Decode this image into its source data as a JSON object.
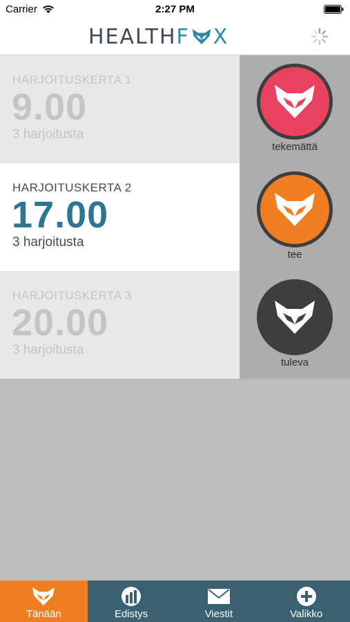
{
  "status_bar": {
    "carrier": "Carrier",
    "time": "2:27 PM"
  },
  "header": {
    "logo_text_left": "HEALTH",
    "logo_text_f": "F",
    "logo_text_x": "X",
    "logo_icon": "fox-head-icon",
    "right_icon": "loading-spinner-icon"
  },
  "sessions": [
    {
      "label": "HARJOITUSKERTA 1",
      "time": "9.00",
      "count": "3 harjoitusta",
      "active": false
    },
    {
      "label": "HARJOITUSKERTA 2",
      "time": "17.00",
      "count": "3 harjoitusta",
      "active": true
    },
    {
      "label": "HARJOITUSKERTA 3",
      "time": "20.00",
      "count": "3 harjoitusta",
      "active": false
    }
  ],
  "statuses": [
    {
      "label": "tekemättä",
      "color": "#e8425f",
      "icon": "fox-head-icon"
    },
    {
      "label": "tee",
      "color": "#f07f22",
      "icon": "fox-head-icon"
    },
    {
      "label": "tuleva",
      "color": "#3e3d3f",
      "icon": "fox-head-icon"
    }
  ],
  "tabs": [
    {
      "label": "Tänään",
      "icon": "fox-head-icon",
      "selected": true
    },
    {
      "label": "Edistys",
      "icon": "progress-chart-icon",
      "selected": false
    },
    {
      "label": "Viestit",
      "icon": "envelope-icon",
      "selected": false
    },
    {
      "label": "Valikko",
      "icon": "plus-circle-icon",
      "selected": false
    }
  ],
  "colors": {
    "accent_orange": "#f07f22",
    "brand_teal": "#2e7592",
    "tab_bar": "#3a6170",
    "missed_red": "#e8425f",
    "upcoming_dark": "#3e3d3f"
  }
}
